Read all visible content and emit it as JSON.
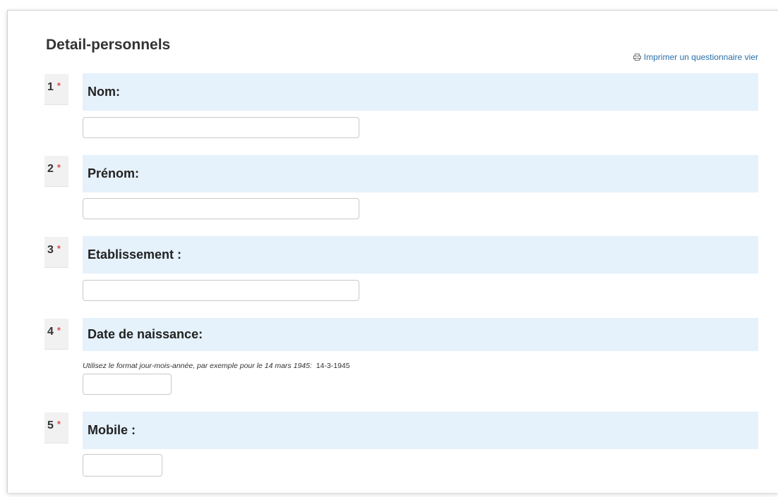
{
  "page": {
    "title": "Detail-personnels",
    "print_link": "Imprimer un questionnaire vier"
  },
  "questions": [
    {
      "number": "1",
      "required": "*",
      "label": "Nom:",
      "value": ""
    },
    {
      "number": "2",
      "required": "*",
      "label": "Prénom:",
      "value": ""
    },
    {
      "number": "3",
      "required": "*",
      "label": "Etablissement :",
      "value": ""
    },
    {
      "number": "4",
      "required": "*",
      "label": "Date de naissance:",
      "value": "",
      "hint": "Utilisez le format jour-mois-année, par exemple pour le 14 mars 1945:",
      "hint_example": "14-3-1945"
    },
    {
      "number": "5",
      "required": "*",
      "label": "Mobile :",
      "value": ""
    }
  ],
  "colors": {
    "question_header_bg": "#e5f1fb",
    "required_star": "#d9534f",
    "link": "#2a6fa8"
  }
}
